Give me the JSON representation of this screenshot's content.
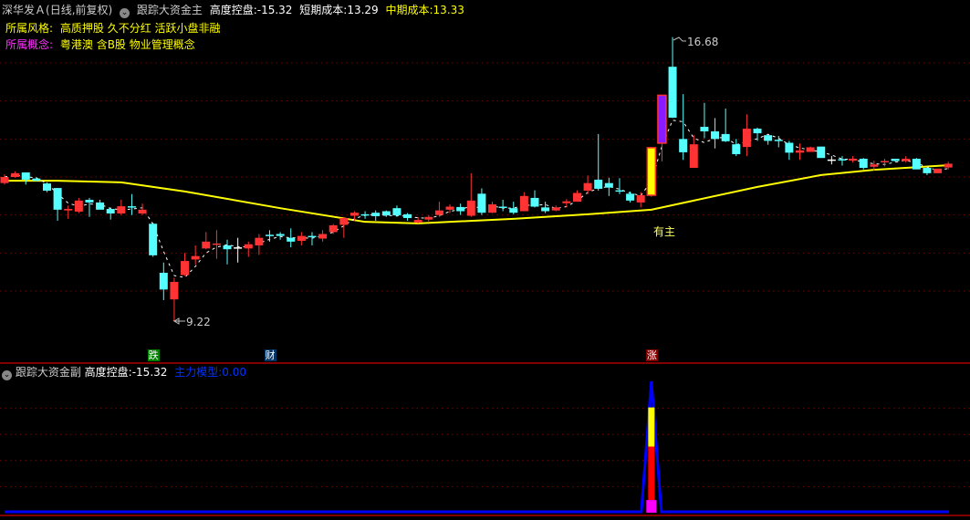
{
  "header": {
    "stock": "深华发Ａ",
    "period": "(日线,前复权)",
    "indicator": "跟踪大资金主",
    "control_label": "高度控盘:",
    "control_value": "-15.32",
    "short_cost_label": "短期成本:",
    "short_cost_value": "13.29",
    "mid_cost_label": "中期成本:",
    "mid_cost_value": "13.33"
  },
  "style": {
    "label": "所属风格:",
    "value": "高质押股 久不分红 活跃小盘非融"
  },
  "concept": {
    "label": "所属概念:",
    "value": "粤港澳 含B股 物业管理概念"
  },
  "annotations": {
    "high": "16.68",
    "low": "9.22",
    "signal": "有主"
  },
  "markers": [
    {
      "text": "跌",
      "index": 14,
      "bg": "#008000"
    },
    {
      "text": "财",
      "index": 25,
      "bg": "#003366"
    },
    {
      "text": "涨",
      "index": 61,
      "bg": "#800000"
    }
  ],
  "sub_header": {
    "indicator": "跟踪大资金副",
    "control_label": "高度控盘:",
    "control_value": "-15.32",
    "model_label": "主力模型:",
    "model_value": "0.00"
  },
  "colors": {
    "up": "#ff3333",
    "down": "#55ffff",
    "doji": "#ffffff",
    "ma": "#ffff00",
    "grid": "#7a0000",
    "blue": "#0000ff",
    "magenta": "#ff00ff",
    "purple": "#8a1aff"
  },
  "chart_data": {
    "type": "candlestick",
    "price_grid": [
      16,
      15,
      14,
      13,
      12,
      11,
      10
    ],
    "candles": [
      [
        12.84,
        13.07,
        12.8,
        13.0
      ],
      [
        13.0,
        13.15,
        12.98,
        13.1
      ],
      [
        13.12,
        13.12,
        12.8,
        12.93
      ],
      [
        12.96,
        13.0,
        12.88,
        12.9
      ],
      [
        12.83,
        12.86,
        12.6,
        12.64
      ],
      [
        12.71,
        12.71,
        11.85,
        12.14
      ],
      [
        12.12,
        12.25,
        11.9,
        12.16
      ],
      [
        12.09,
        12.45,
        12.05,
        12.38
      ],
      [
        12.4,
        12.45,
        11.95,
        12.33
      ],
      [
        12.33,
        12.4,
        12.3,
        12.14
      ],
      [
        12.16,
        12.2,
        11.88,
        12.04
      ],
      [
        12.04,
        12.4,
        12.0,
        12.23
      ],
      [
        12.23,
        12.55,
        12.0,
        12.2
      ],
      [
        12.04,
        12.3,
        12.0,
        12.14
      ],
      [
        11.77,
        11.8,
        10.9,
        10.94
      ],
      [
        10.48,
        10.75,
        9.76,
        10.04
      ],
      [
        9.78,
        10.35,
        9.22,
        10.24
      ],
      [
        10.42,
        11.0,
        10.4,
        10.79
      ],
      [
        10.83,
        11.2,
        10.7,
        10.92
      ],
      [
        11.12,
        11.55,
        11.1,
        11.3
      ],
      [
        11.23,
        11.6,
        10.85,
        11.25
      ],
      [
        11.2,
        11.35,
        10.7,
        11.1
      ],
      [
        11.15,
        11.4,
        10.75,
        11.15
      ],
      [
        11.12,
        11.3,
        10.9,
        11.23
      ],
      [
        11.2,
        11.5,
        10.95,
        11.4
      ],
      [
        11.48,
        11.6,
        11.3,
        11.45
      ],
      [
        11.5,
        11.55,
        11.35,
        11.45
      ],
      [
        11.4,
        11.65,
        11.15,
        11.3
      ],
      [
        11.32,
        11.55,
        11.2,
        11.45
      ],
      [
        11.45,
        11.55,
        11.2,
        11.42
      ],
      [
        11.38,
        11.6,
        11.3,
        11.5
      ],
      [
        11.55,
        11.76,
        11.5,
        11.73
      ],
      [
        11.74,
        11.95,
        11.4,
        11.92
      ],
      [
        11.98,
        12.1,
        11.85,
        12.06
      ],
      [
        12.02,
        12.1,
        11.9,
        12.0
      ],
      [
        12.06,
        12.12,
        11.85,
        11.97
      ],
      [
        12.1,
        12.12,
        11.95,
        11.99
      ],
      [
        12.18,
        12.25,
        11.95,
        11.99
      ],
      [
        12.02,
        12.05,
        11.85,
        11.92
      ],
      [
        11.8,
        11.95,
        11.78,
        11.87
      ],
      [
        11.88,
        12.0,
        11.8,
        11.95
      ],
      [
        12.0,
        12.35,
        11.95,
        12.12
      ],
      [
        12.14,
        12.28,
        12.05,
        12.22
      ],
      [
        12.21,
        12.3,
        12.0,
        12.1
      ],
      [
        11.98,
        13.1,
        11.95,
        12.38
      ],
      [
        12.56,
        12.7,
        12.0,
        12.06
      ],
      [
        12.06,
        12.35,
        12.05,
        12.28
      ],
      [
        12.22,
        12.4,
        12.1,
        12.2
      ],
      [
        12.18,
        12.35,
        12.02,
        12.06
      ],
      [
        12.1,
        12.6,
        12.1,
        12.5
      ],
      [
        12.45,
        12.65,
        12.2,
        12.22
      ],
      [
        12.2,
        12.35,
        12.05,
        12.1
      ],
      [
        12.12,
        12.25,
        12.1,
        12.2
      ],
      [
        12.31,
        12.42,
        12.2,
        12.36
      ],
      [
        12.35,
        12.65,
        12.35,
        12.58
      ],
      [
        12.64,
        13.04,
        12.55,
        12.84
      ],
      [
        12.93,
        14.13,
        12.64,
        12.69
      ],
      [
        12.84,
        12.98,
        12.5,
        12.72
      ],
      [
        12.65,
        12.97,
        12.55,
        12.63
      ],
      [
        12.56,
        12.62,
        12.33,
        12.38
      ],
      [
        12.33,
        12.6,
        12.2,
        12.52
      ],
      [
        12.52,
        13.77,
        12.48,
        13.77
      ],
      [
        13.89,
        15.15,
        13.41,
        15.15
      ],
      [
        15.9,
        16.68,
        14.55,
        14.56
      ],
      [
        14.0,
        15.18,
        13.45,
        13.65
      ],
      [
        13.24,
        14.1,
        13.24,
        13.86
      ],
      [
        14.32,
        14.95,
        14.02,
        14.2
      ],
      [
        14.2,
        14.55,
        13.75,
        14.0
      ],
      [
        14.13,
        14.8,
        13.92,
        13.94
      ],
      [
        13.86,
        14.0,
        13.55,
        13.6
      ],
      [
        13.79,
        14.65,
        13.55,
        14.27
      ],
      [
        14.27,
        14.3,
        13.95,
        14.15
      ],
      [
        14.1,
        14.1,
        13.85,
        13.95
      ],
      [
        13.98,
        14.08,
        13.78,
        13.96
      ],
      [
        13.9,
        13.95,
        13.45,
        13.64
      ],
      [
        13.64,
        13.88,
        13.45,
        13.7
      ],
      [
        13.66,
        13.8,
        13.66,
        13.78
      ],
      [
        13.8,
        13.8,
        13.5,
        13.5
      ],
      [
        13.46,
        13.55,
        13.33,
        13.46
      ],
      [
        13.47,
        13.55,
        13.3,
        13.45
      ],
      [
        13.43,
        13.55,
        13.38,
        13.48
      ],
      [
        13.48,
        13.5,
        13.2,
        13.24
      ],
      [
        13.27,
        13.43,
        13.17,
        13.33
      ],
      [
        13.4,
        13.48,
        13.28,
        13.42
      ],
      [
        13.48,
        13.48,
        13.4,
        13.42
      ],
      [
        13.42,
        13.55,
        13.38,
        13.48
      ],
      [
        13.48,
        13.5,
        13.2,
        13.2
      ],
      [
        13.24,
        13.24,
        13.05,
        13.1
      ],
      [
        13.1,
        13.22,
        13.1,
        13.22
      ],
      [
        13.25,
        13.4,
        13.2,
        13.35
      ]
    ],
    "candle_fields": [
      "open",
      "high",
      "low",
      "close"
    ],
    "highlight": {
      "61": "ma",
      "62": "purple"
    },
    "mid_cost_line": [
      [
        0,
        12.9
      ],
      [
        5,
        12.9
      ],
      [
        11,
        12.86
      ],
      [
        17,
        12.62
      ],
      [
        26,
        12.18
      ],
      [
        34,
        11.82
      ],
      [
        39,
        11.78
      ],
      [
        48,
        11.9
      ],
      [
        55,
        12.02
      ],
      [
        61,
        12.14
      ],
      [
        65,
        12.38
      ],
      [
        71,
        12.74
      ],
      [
        77,
        13.05
      ],
      [
        82,
        13.19
      ],
      [
        89,
        13.31
      ]
    ],
    "sub": {
      "ylim": [
        0,
        100
      ],
      "spike_index": 61,
      "peak": 100,
      "magenta_top": 9,
      "red_top": 50,
      "yellow_top": 80,
      "grid": [
        20,
        40,
        60,
        80
      ]
    }
  }
}
